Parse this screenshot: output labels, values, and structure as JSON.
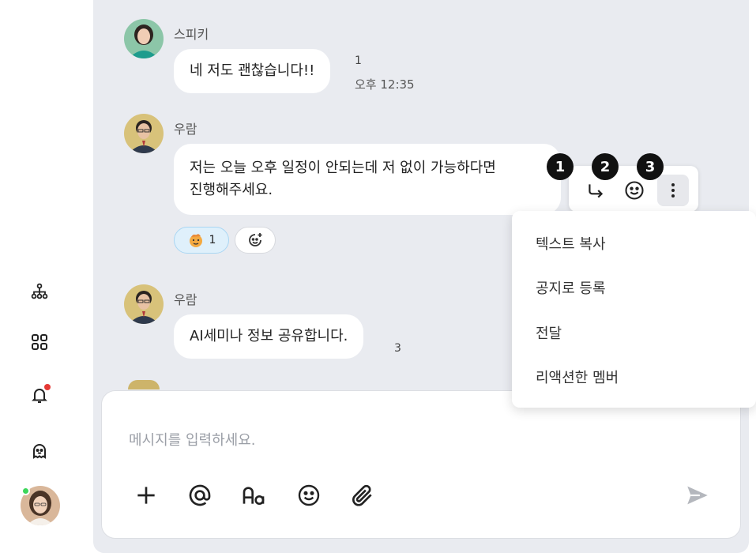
{
  "messages": [
    {
      "sender": "스피키",
      "text": "네 저도 괜찮습니다!!",
      "unread": "1",
      "time": "오후 12:35"
    },
    {
      "sender": "우람",
      "text_line1": "저는 오늘 오후 일정이 안되는데 저 없이 가능하다면",
      "text_line2": "진행해주세요.",
      "reaction_count": "1"
    },
    {
      "sender": "우람",
      "text": "AI세미나 정보 공유합니다.",
      "unread": "3"
    }
  ],
  "action_badges": [
    "1",
    "2",
    "3"
  ],
  "action_icons": [
    "reply-arrow-icon",
    "emoji-icon",
    "more-vertical-icon"
  ],
  "context_menu": {
    "items": [
      "텍스트 복사",
      "공지로 등록",
      "전달",
      "리액션한 멤버"
    ]
  },
  "composer": {
    "placeholder": "메시지를 입력하세요.",
    "tools": [
      "plus-icon",
      "mention-icon",
      "text-format-icon",
      "emoji-icon",
      "attach-icon",
      "send-icon"
    ]
  },
  "sidebar": {
    "icons": [
      "org-chart-icon",
      "apps-grid-icon",
      "bell-icon",
      "ghost-icon",
      "user-avatar"
    ]
  },
  "colors": {
    "chat_bg": "#e9ebf0",
    "reaction_active_bg": "#dff0fb",
    "notification": "#e53935",
    "online": "#3dd65b"
  }
}
